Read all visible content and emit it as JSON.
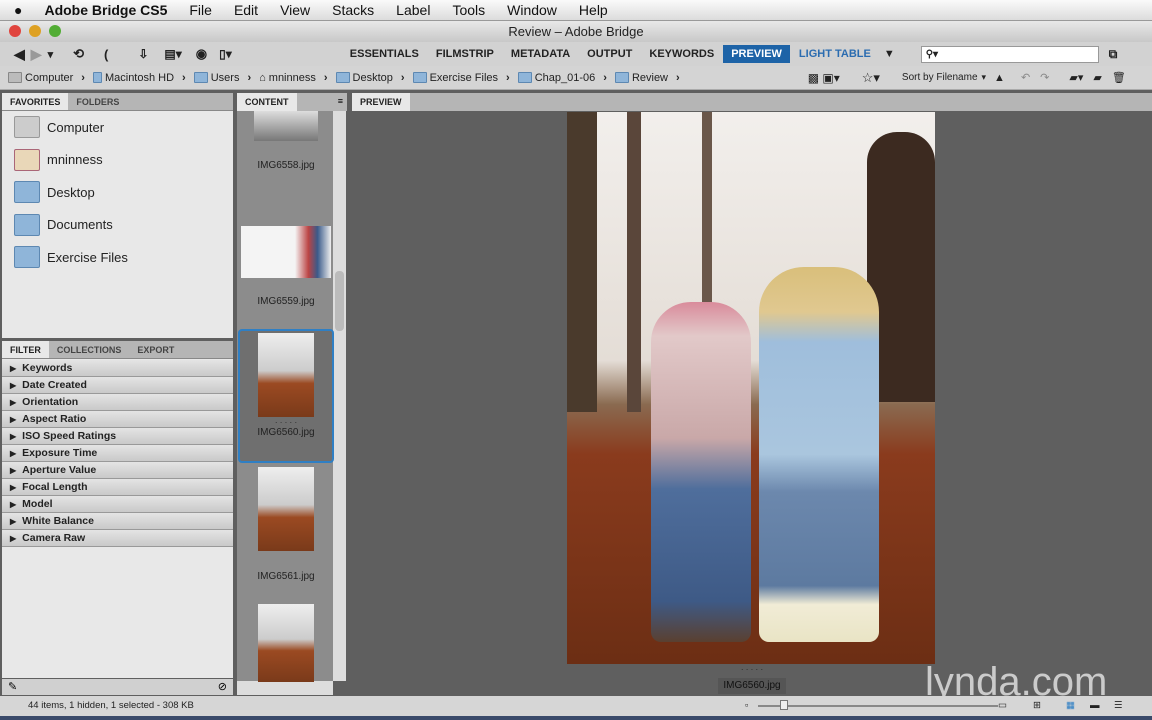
{
  "menubar": {
    "apple": "",
    "app": "Adobe Bridge CS5",
    "items": [
      "File",
      "Edit",
      "View",
      "Stacks",
      "Label",
      "Tools",
      "Window",
      "Help"
    ]
  },
  "window": {
    "title": "Review – Adobe Bridge"
  },
  "workspaces": [
    "ESSENTIALS",
    "FILMSTRIP",
    "METADATA",
    "OUTPUT",
    "KEYWORDS",
    "PREVIEW",
    "LIGHT TABLE"
  ],
  "search": {
    "placeholder": ""
  },
  "path": [
    "Computer",
    "Macintosh HD",
    "Users",
    "mninness",
    "Desktop",
    "Exercise Files",
    "Chap_01-06",
    "Review"
  ],
  "sort_label": "Sort by Filename",
  "left_tabs": [
    "FAVORITES",
    "FOLDERS"
  ],
  "favorites": [
    "Computer",
    "mninness",
    "Desktop",
    "Documents",
    "Exercise Files"
  ],
  "filter_tabs": [
    "FILTER",
    "COLLECTIONS",
    "EXPORT"
  ],
  "filters": [
    "Keywords",
    "Date Created",
    "Orientation",
    "Aspect Ratio",
    "ISO Speed Ratings",
    "Exposure Time",
    "Aperture Value",
    "Focal Length",
    "Model",
    "White Balance",
    "Camera Raw"
  ],
  "content_tab": "CONTENT",
  "preview_tab": "PREVIEW",
  "thumbnails": [
    "IMG6558.jpg",
    "IMG6559.jpg",
    "IMG6560.jpg",
    "IMG6561.jpg"
  ],
  "preview": {
    "filename": "IMG6560.jpg",
    "rating": "· · · · ·"
  },
  "status": "44 items, 1 hidden, 1 selected - 308 KB",
  "watermark": "lynda.com",
  "colors": {
    "accent": "#1d63a7",
    "panel": "#5f5f5f"
  }
}
